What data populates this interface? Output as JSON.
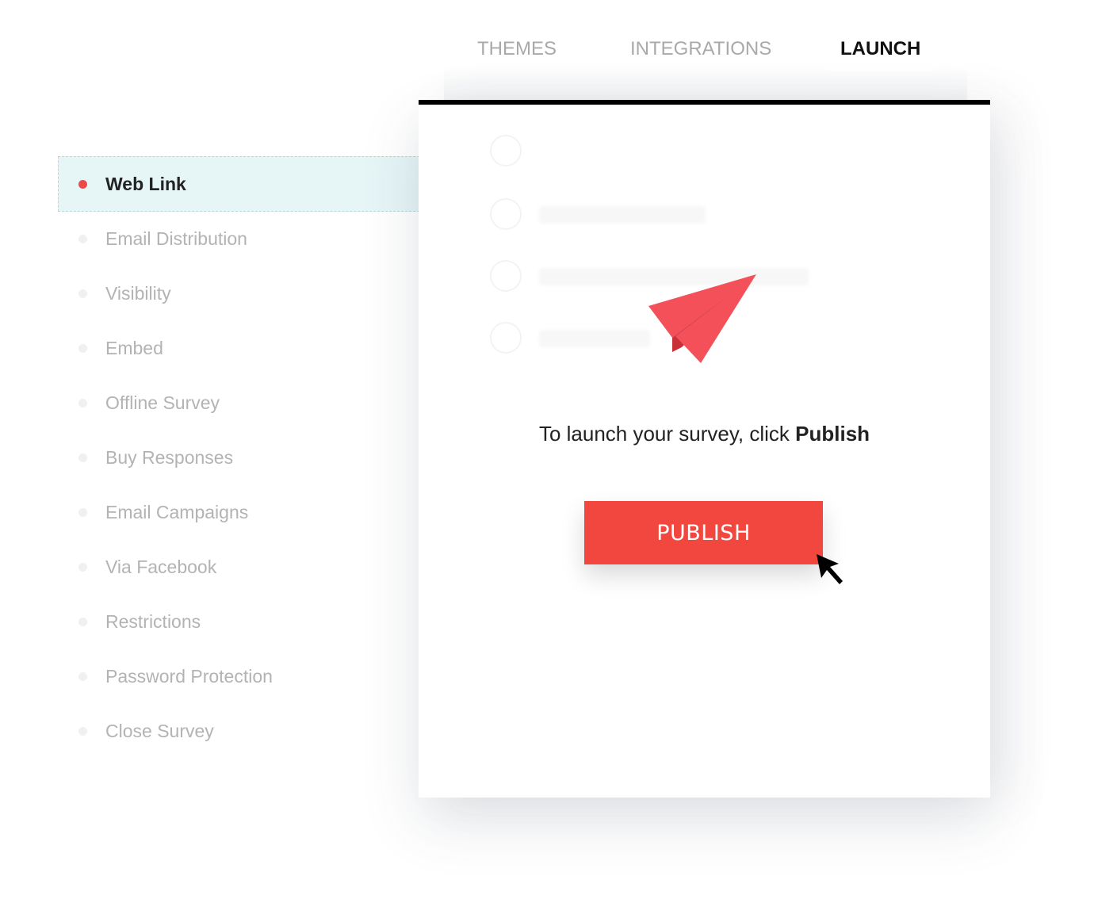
{
  "tabs": [
    {
      "label": "THEMES",
      "active": false
    },
    {
      "label": "INTEGRATIONS",
      "active": false
    },
    {
      "label": "LAUNCH",
      "active": true
    }
  ],
  "sidebar": {
    "items": [
      {
        "label": "Web Link",
        "active": true
      },
      {
        "label": "Email Distribution"
      },
      {
        "label": "Visibility"
      },
      {
        "label": "Embed"
      },
      {
        "label": "Offline Survey"
      },
      {
        "label": "Buy Responses"
      },
      {
        "label": "Email Campaigns"
      },
      {
        "label": "Via Facebook"
      },
      {
        "label": "Restrictions"
      },
      {
        "label": "Password Protection"
      },
      {
        "label": "Close Survey"
      }
    ]
  },
  "main": {
    "icon": "paper-plane-icon",
    "message_prefix": "To launch your survey, click ",
    "message_emphasis": "Publish",
    "publish_label": "PUBLISH"
  },
  "colors": {
    "accent": "#f2473f",
    "active_bg": "#e6f5f6",
    "active_dot": "#ef4a4a"
  }
}
